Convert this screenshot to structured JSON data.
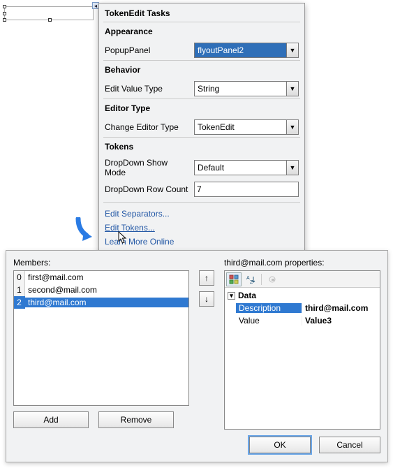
{
  "tasks": {
    "title": "TokenEdit Tasks",
    "sections": {
      "appearance": "Appearance",
      "behavior": "Behavior",
      "editorType": "Editor Type",
      "tokens": "Tokens"
    },
    "labels": {
      "popupPanel": "PopupPanel",
      "editValueType": "Edit Value Type",
      "changeEditorType": "Change Editor Type",
      "dropdownShowMode": "DropDown Show Mode",
      "dropdownRowCount": "DropDown Row Count"
    },
    "values": {
      "popupPanel": "flyoutPanel2",
      "editValueType": "String",
      "changeEditorType": "TokenEdit",
      "dropdownShowMode": "Default",
      "dropdownRowCount": "7"
    },
    "links": {
      "editSeparators": "Edit Separators...",
      "editTokens": "Edit Tokens...",
      "learnMore": "Learn More Online"
    }
  },
  "dialog": {
    "membersLabel": "Members:",
    "propsLabelPrefix": "third@mail.com",
    "propsLabelSuffix": " properties:",
    "members": [
      {
        "index": "0",
        "text": "first@mail.com"
      },
      {
        "index": "1",
        "text": "second@mail.com"
      },
      {
        "index": "2",
        "text": "third@mail.com"
      }
    ],
    "buttons": {
      "add": "Add",
      "remove": "Remove",
      "up": "↑",
      "down": "↓",
      "ok": "OK",
      "cancel": "Cancel"
    },
    "propgrid": {
      "categoryName": "Data",
      "props": [
        {
          "name": "Description",
          "value": "third@mail.com"
        },
        {
          "name": "Value",
          "value": "Value3"
        }
      ]
    }
  }
}
